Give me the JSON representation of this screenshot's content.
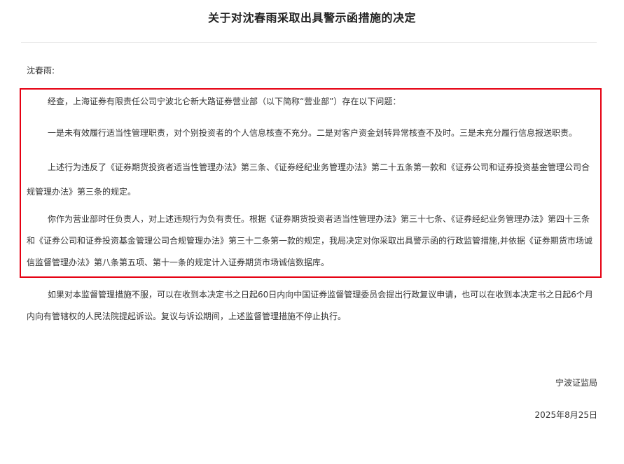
{
  "document": {
    "title": "关于对沈春雨采取出具警示函措施的决定",
    "salutation": "沈春雨:",
    "paragraphs": {
      "p1": [
        "经查，上海证券有限责任公司宁波北仑新大路证券营业部（以下简称“营业部”）存在以下问题："
      ],
      "p2": [
        "一是未有效履行适当性管理职责，对个别投资者的个人信息核查不充分。二是对客户资金划转异常核查不及时。三是未充分履行信息报送职责。"
      ],
      "p3": [
        "上述行为违反了《证券期货投资者适当性管理办法》第三条、《证券经纪业务管理办法》第二十五条第一款和《证券公司和证券投资基金管理公司合",
        "规管理办法》第三条的规定。"
      ],
      "p4": [
        "你作为营业部时任负责人，对上述违规行为负有责任。根据《证券期货投资者适当性管理办法》第三十七条、《证券经纪业务管理办法》第四十三条",
        "和《证券公司和证券投资基金管理公司合规管理办法》第三十二条第一款的规定，我局决定对你采取出具警示函的行政监管措施,并依据《证券期货市场诚",
        "信监督管理办法》第八条第五项、第十一条的规定计入证券期货市场诚信数据库。"
      ],
      "p5": [
        "如果对本监督管理措施不服，可以在收到本决定书之日起60日内向中国证券监督管理委员会提出行政复议申请，也可以在收到本决定书之日起6个月",
        "内向有管辖权的人民法院提起诉讼。复议与诉讼期间，上述监督管理措施不停止执行。"
      ]
    },
    "signature": "宁波证监局",
    "date": "2025年8月25日"
  },
  "colors": {
    "highlight_border": "#e60012",
    "text": "#333333",
    "divider": "#e6e6e6"
  }
}
